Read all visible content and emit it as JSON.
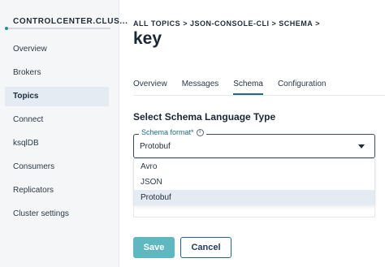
{
  "sidebar": {
    "cluster_name": "CONTROLCENTER.CLUS...",
    "items": [
      {
        "label": "Overview"
      },
      {
        "label": "Brokers"
      },
      {
        "label": "Topics"
      },
      {
        "label": "Connect"
      },
      {
        "label": "ksqlDB"
      },
      {
        "label": "Consumers"
      },
      {
        "label": "Replicators"
      },
      {
        "label": "Cluster settings"
      }
    ],
    "active_item": "Topics"
  },
  "breadcrumb": [
    "ALL TOPICS",
    "JSON-CONSOLE-CLI",
    "SCHEMA"
  ],
  "breadcrumb_separator": ">",
  "page_title": "key",
  "tabs": [
    {
      "label": "Overview"
    },
    {
      "label": "Messages"
    },
    {
      "label": "Schema"
    },
    {
      "label": "Configuration"
    }
  ],
  "active_tab": "Schema",
  "section_title": "Select Schema Language Type",
  "schema_select": {
    "label": "Schema format*",
    "info_glyph": "i",
    "value": "Protobuf",
    "options": [
      "Avro",
      "JSON",
      "Protobuf"
    ]
  },
  "buttons": {
    "save": "Save",
    "cancel": "Cancel"
  },
  "colors": {
    "accent": "#1c6a8a",
    "save_button": "#5fb7bf",
    "active_nav_bg": "#e4ebf2"
  }
}
